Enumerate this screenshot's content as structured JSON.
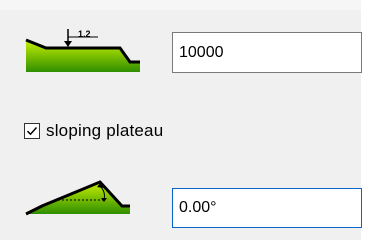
{
  "plateau_height": {
    "icon": "plateau-height-icon",
    "icon_label": "1.2",
    "value": "10000"
  },
  "sloping_plateau": {
    "label": "sloping plateau",
    "checked": true
  },
  "slope_angle": {
    "icon": "slope-angle-icon",
    "value": "0.00°"
  },
  "colors": {
    "terrain_fill_top": "#c8f000",
    "terrain_fill_bottom": "#2f8e00",
    "input_focus_border": "#0a64c8",
    "input_border": "#7a7a7a"
  }
}
